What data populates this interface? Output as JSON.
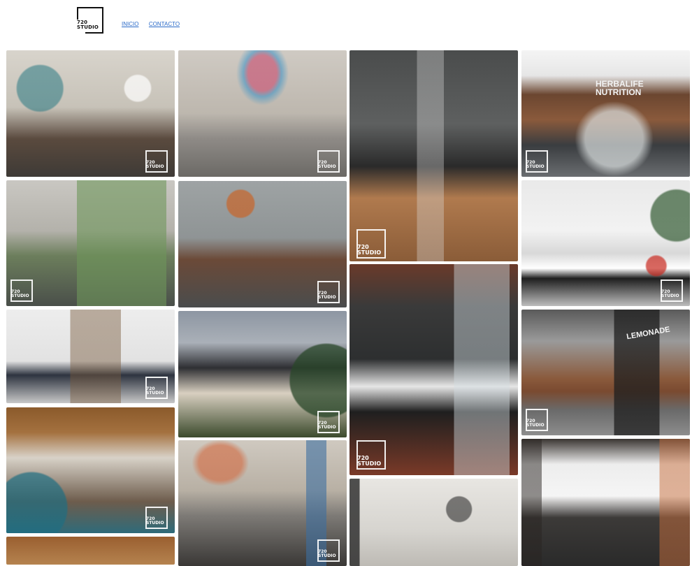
{
  "logo": {
    "line1": "720",
    "line2": "STUDIO"
  },
  "nav": {
    "inicio": "INICIO",
    "contacto": "CONTACTO"
  },
  "watermark": {
    "line1": "720",
    "line2": "STUDIO"
  },
  "signage": {
    "herbalife_1": "HERBALIFE",
    "herbalife_2": "NUTRITION",
    "lemonade": "LEMONADE"
  },
  "colors": {
    "link": "#2a6ac8",
    "logo": "#111111"
  }
}
